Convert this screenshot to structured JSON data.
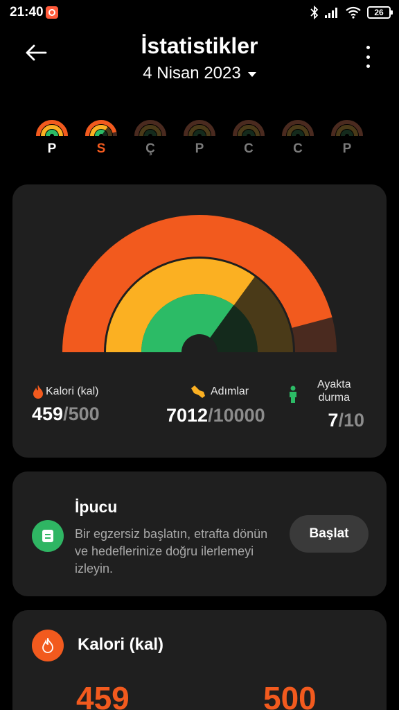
{
  "status_bar": {
    "time": "21:40",
    "battery": "26"
  },
  "header": {
    "title": "İstatistikler",
    "date": "4 Nisan 2023"
  },
  "week": [
    {
      "letter": "P",
      "state": "done"
    },
    {
      "letter": "S",
      "state": "today"
    },
    {
      "letter": "Ç",
      "state": "future"
    },
    {
      "letter": "P",
      "state": "future"
    },
    {
      "letter": "C",
      "state": "future"
    },
    {
      "letter": "C",
      "state": "future"
    },
    {
      "letter": "P",
      "state": "future"
    }
  ],
  "summary": {
    "calories": {
      "label": "Kalori (kal)",
      "value": "459",
      "goal": "/500",
      "fraction": 0.918
    },
    "steps": {
      "label": "Adımlar",
      "value": "7012",
      "goal": "/10000",
      "fraction": 0.7012
    },
    "standing": {
      "label_line1": "Ayakta",
      "label_line2": "durma",
      "value": "7",
      "goal": "/10",
      "fraction": 0.7
    }
  },
  "tip": {
    "title": "İpucu",
    "text": "Bir egzersiz başlatın, etrafta dönün ve hedeflerinize doğru ilerlemeyi izleyin.",
    "button": "Başlat"
  },
  "calorie_card": {
    "title": "Kalori (kal)",
    "value": "459",
    "goal": "500"
  },
  "colors": {
    "calories": "#f25a1e",
    "calories_dim": "#4a2a1f",
    "steps": "#fbb022",
    "steps_dim": "#4a3a18",
    "standing": "#2cbb66",
    "standing_dim": "#142a1c",
    "card": "#1f1f1f"
  }
}
